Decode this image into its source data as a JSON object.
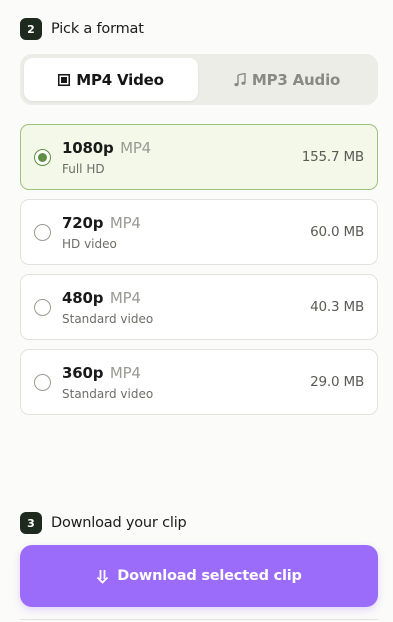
{
  "step2": {
    "number": "2",
    "title": "Pick a format"
  },
  "tabs": [
    {
      "label": "MP4 Video",
      "icon": "film-icon",
      "active": true
    },
    {
      "label": "MP3 Audio",
      "icon": "music-note-icon",
      "active": false
    }
  ],
  "options": [
    {
      "resolution": "1080p",
      "format": "MP4",
      "description": "Full HD",
      "size": "155.7 MB",
      "selected": true
    },
    {
      "resolution": "720p",
      "format": "MP4",
      "description": "HD video",
      "size": "60.0 MB",
      "selected": false
    },
    {
      "resolution": "480p",
      "format": "MP4",
      "description": "Standard video",
      "size": "40.3 MB",
      "selected": false
    },
    {
      "resolution": "360p",
      "format": "MP4",
      "description": "Standard video",
      "size": "29.0 MB",
      "selected": false
    }
  ],
  "step3": {
    "number": "3",
    "title": "Download your clip"
  },
  "download": {
    "label": "Download selected clip",
    "icon": "download-arrow-icon"
  },
  "colors": {
    "accent": "#9b6cfa",
    "selected_bg": "#f3f8e8",
    "selected_border": "#9dc27d",
    "radio_selected": "#5f8f43",
    "step_badge": "#1d2a1d"
  }
}
